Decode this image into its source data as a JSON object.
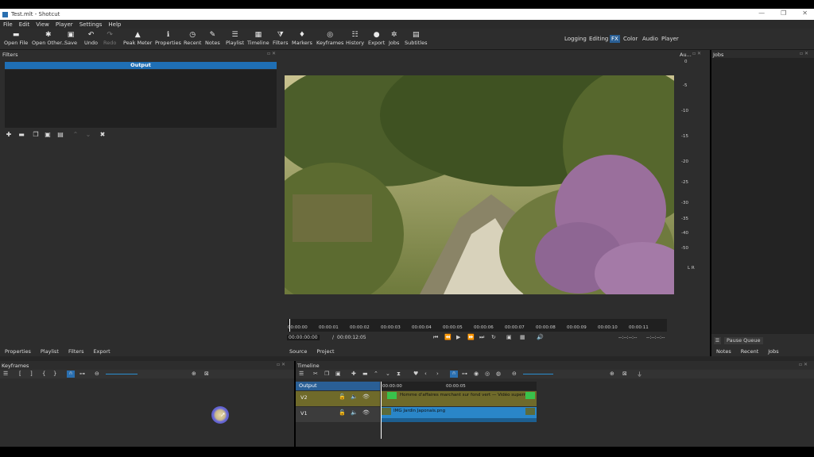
{
  "window": {
    "title": "Test.mlt - Shotcut",
    "controls": [
      "—",
      "❐",
      "✕"
    ]
  },
  "menubar": [
    "File",
    "Edit",
    "View",
    "Player",
    "Settings",
    "Help"
  ],
  "toolbar": {
    "open_file": "Open File",
    "open_other": "Open Other..",
    "save": "Save",
    "undo": "Undo",
    "redo": "Redo",
    "peak_meter": "Peak Meter",
    "properties": "Properties",
    "recent": "Recent",
    "notes": "Notes",
    "playlist": "Playlist",
    "timeline": "Timeline",
    "filters": "Filters",
    "markers": "Markers",
    "keyframes": "Keyframes",
    "history": "History",
    "export": "Export",
    "jobs": "Jobs",
    "subtitles": "Subtitles"
  },
  "workspaces": [
    "Logging",
    "Editing",
    "FX",
    "Color",
    "Audio",
    "Player"
  ],
  "active_workspace": "FX",
  "filters": {
    "title": "Filters",
    "output_label": "Output"
  },
  "left_tabs": [
    "Properties",
    "Playlist",
    "Filters",
    "Export"
  ],
  "player": {
    "ruler_ticks": [
      "00:00:00",
      "00:00:01",
      "00:00:02",
      "00:00:03",
      "00:00:04",
      "00:00:05",
      "00:00:06",
      "00:00:07",
      "00:00:08",
      "00:00:09",
      "00:00:10",
      "00:00:11"
    ],
    "position": "00:00:00:00",
    "separator": "/",
    "duration": "00:00:12:05",
    "in_point": "--:--:--:--",
    "out_point": "--:--:--:--",
    "tabs": [
      "Source",
      "Project"
    ]
  },
  "audio_meter": {
    "title": "Au...",
    "scale": [
      "0",
      "-5",
      "-10",
      "-15",
      "-20",
      "-25",
      "-30",
      "-35",
      "-40",
      "-50"
    ],
    "channels": "L R"
  },
  "jobs": {
    "title": "Jobs",
    "pause_queue": "Pause Queue",
    "tabs": [
      "Notes",
      "Recent",
      "Jobs"
    ]
  },
  "keyframes": {
    "title": "Keyframes"
  },
  "timeline": {
    "title": "Timeline",
    "output_label": "Output",
    "ruler": [
      "00:00:00",
      "00:00:05"
    ],
    "tracks": [
      {
        "name": "V2",
        "clip": "Homme d'affaires marchant sur fond vert — Vidéo superm"
      },
      {
        "name": "V1",
        "clip": "IMG Jardin Japonais.png"
      }
    ]
  }
}
